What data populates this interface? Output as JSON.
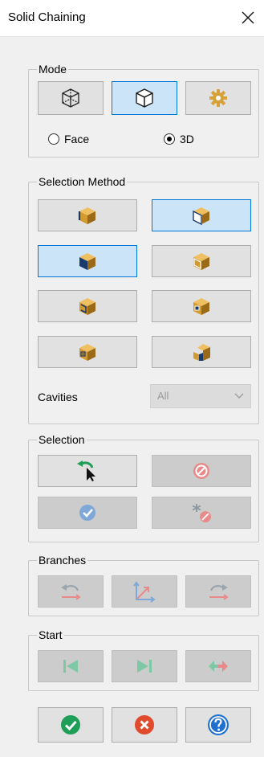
{
  "window": {
    "title": "Solid Chaining",
    "close_icon": "close-icon"
  },
  "mode": {
    "legend": "Mode",
    "buttons": [
      {
        "name": "wireframe",
        "icon": "wireframe-cube-icon",
        "selected": false
      },
      {
        "name": "solid",
        "icon": "solid-cube-icon",
        "selected": true
      },
      {
        "name": "settings",
        "icon": "gear-icon",
        "selected": false
      }
    ],
    "radio_face": "Face",
    "radio_3d": "3D",
    "selected_radio": "3D"
  },
  "selection_method": {
    "legend": "Selection Method",
    "buttons": [
      {
        "name": "edge",
        "icon": "solid-edge-icon",
        "selected": false
      },
      {
        "name": "face",
        "icon": "solid-face-icon",
        "selected": true
      },
      {
        "name": "body",
        "icon": "solid-body-icon",
        "selected": true
      },
      {
        "name": "loop",
        "icon": "solid-loop-icon",
        "selected": false
      },
      {
        "name": "partial-loop",
        "icon": "solid-partial-loop-icon",
        "selected": false
      },
      {
        "name": "feature",
        "icon": "solid-feature-icon",
        "selected": false
      },
      {
        "name": "cavity",
        "icon": "solid-cavity-icon",
        "selected": false
      },
      {
        "name": "step",
        "icon": "solid-step-icon",
        "selected": false
      }
    ],
    "cavities_label": "Cavities",
    "cavities_value": "All"
  },
  "selection": {
    "legend": "Selection",
    "buttons": [
      {
        "name": "select-back",
        "icon": "select-back-arrow-icon",
        "enabled": true
      },
      {
        "name": "clear",
        "icon": "clear-no-icon",
        "enabled": false
      },
      {
        "name": "add",
        "icon": "add-check-icon",
        "enabled": false
      },
      {
        "name": "unselect-all",
        "icon": "unselect-all-icon",
        "enabled": false
      }
    ]
  },
  "branches": {
    "legend": "Branches",
    "buttons": [
      {
        "name": "branch-back",
        "icon": "branch-back-icon"
      },
      {
        "name": "branch-axes",
        "icon": "branch-axes-icon"
      },
      {
        "name": "branch-forward",
        "icon": "branch-forward-icon"
      }
    ]
  },
  "start": {
    "legend": "Start",
    "buttons": [
      {
        "name": "start-first",
        "icon": "skip-start-icon"
      },
      {
        "name": "start-last",
        "icon": "skip-end-icon"
      },
      {
        "name": "start-reverse",
        "icon": "reverse-arrows-icon"
      }
    ]
  },
  "footer": {
    "buttons": [
      {
        "name": "ok",
        "icon": "ok-check-icon",
        "color": "#1f9e57"
      },
      {
        "name": "cancel",
        "icon": "cancel-x-icon",
        "color": "#e04a2d"
      },
      {
        "name": "help",
        "icon": "help-question-icon",
        "color": "#1e6fd0"
      }
    ]
  },
  "colors": {
    "cube_light": "#f0c060",
    "cube_mid": "#d29a30",
    "cube_dark": "#9a6a18",
    "selected_face": "#1a3a6b",
    "accent": "#0078d7",
    "disabled_icon": "#9aa5ad"
  }
}
